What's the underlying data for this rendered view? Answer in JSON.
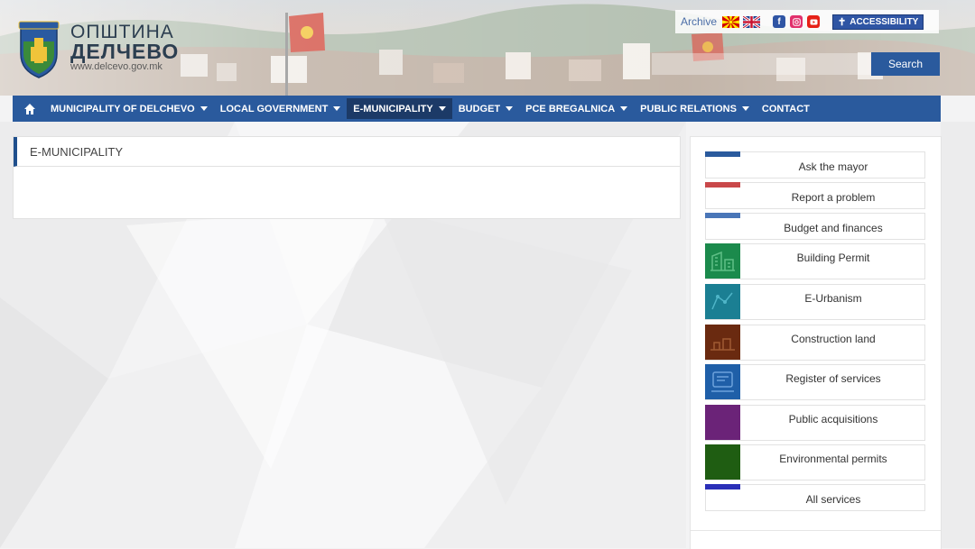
{
  "header": {
    "logo_line1": "ОПШТИНА",
    "logo_line2": "ДЕЛЧЕВО",
    "logo_url": "www.delcevo.gov.mk",
    "archive_label": "Archive",
    "accessibility_label": "ACCESSIBILITY",
    "search_placeholder": "",
    "search_button": "Search"
  },
  "nav": {
    "items": [
      {
        "label": "MUNICIPALITY OF DELCHEVO",
        "dropdown": true
      },
      {
        "label": "LOCAL GOVERNMENT",
        "dropdown": true
      },
      {
        "label": "E-MUNICIPALITY",
        "dropdown": true,
        "active": true
      },
      {
        "label": "BUDGET",
        "dropdown": true
      },
      {
        "label": "PCE BREGALNICA",
        "dropdown": true
      },
      {
        "label": "PUBLIC RELATIONS",
        "dropdown": true
      },
      {
        "label": "CONTACT",
        "dropdown": false
      }
    ]
  },
  "main": {
    "title": "E-MUNICIPALITY"
  },
  "sidebar": {
    "services": [
      {
        "label": "Ask the mayor",
        "color": "#2a5a9d",
        "icon": "bar"
      },
      {
        "label": "Report a problem",
        "color": "#c9484a",
        "icon": "bar"
      },
      {
        "label": "Budget and finances",
        "color": "#4a76b8",
        "icon": "bar"
      },
      {
        "label": "Building Permit",
        "color": "#1b8a4c",
        "icon": "building-icon"
      },
      {
        "label": "E-Urbanism",
        "color": "#1b7f93",
        "icon": "urbanism-icon"
      },
      {
        "label": "Construction land",
        "color": "#6a2a10",
        "icon": "land-icon"
      },
      {
        "label": "Register of services",
        "color": "#1f5fa8",
        "icon": "register-icon"
      },
      {
        "label": "Public acquisitions",
        "color": "#6b2378",
        "icon": "acquisitions-icon"
      },
      {
        "label": "Environmental permits",
        "color": "#1f5d12",
        "icon": "environment-icon"
      },
      {
        "label": "All services",
        "color": "#2b2fb8",
        "icon": "bar"
      }
    ]
  },
  "colors": {
    "primary": "#2a5a9d",
    "nav_active": "#1c3a67"
  }
}
